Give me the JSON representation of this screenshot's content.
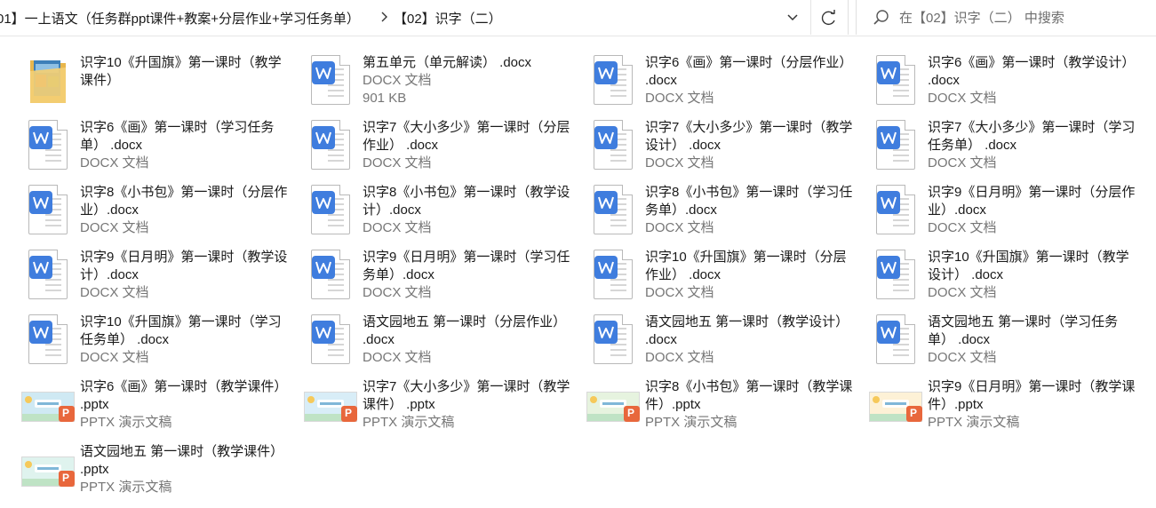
{
  "breadcrumb": {
    "path_label": "01】一上语文（任务群ppt课件+教案+分层作业+学习任务单）",
    "current_label": "【02】识字（二）"
  },
  "search": {
    "placeholder": "在【02】识字（二） 中搜索"
  },
  "files": [
    {
      "name": "识字10《升国旗》第一课时（教学课件）",
      "type": "",
      "size": "",
      "icon": "folder-icon"
    },
    {
      "name": "第五单元（单元解读） .docx",
      "type": "DOCX 文档",
      "size": "901 KB",
      "icon": "word-doc-icon"
    },
    {
      "name": "识字6《画》第一课时（分层作业） .docx",
      "type": "DOCX 文档",
      "size": "",
      "icon": "word-doc-icon"
    },
    {
      "name": "识字6《画》第一课时（教学设计） .docx",
      "type": "DOCX 文档",
      "size": "",
      "icon": "word-doc-icon"
    },
    {
      "name": "识字6《画》第一课时（学习任务单） .docx",
      "type": "DOCX 文档",
      "size": "",
      "icon": "word-doc-icon"
    },
    {
      "name": "识字7《大小多少》第一课时（分层作业） .docx",
      "type": "DOCX 文档",
      "size": "",
      "icon": "word-doc-icon"
    },
    {
      "name": "识字7《大小多少》第一课时（教学设计） .docx",
      "type": "DOCX 文档",
      "size": "",
      "icon": "word-doc-icon"
    },
    {
      "name": "识字7《大小多少》第一课时（学习任务单） .docx",
      "type": "DOCX 文档",
      "size": "",
      "icon": "word-doc-icon"
    },
    {
      "name": "识字8《小书包》第一课时（分层作业）.docx",
      "type": "DOCX 文档",
      "size": "",
      "icon": "word-doc-icon"
    },
    {
      "name": "识字8《小书包》第一课时（教学设计）.docx",
      "type": "DOCX 文档",
      "size": "",
      "icon": "word-doc-icon"
    },
    {
      "name": "识字8《小书包》第一课时（学习任务单）.docx",
      "type": "DOCX 文档",
      "size": "",
      "icon": "word-doc-icon"
    },
    {
      "name": "识字9《日月明》第一课时（分层作业）.docx",
      "type": "DOCX 文档",
      "size": "",
      "icon": "word-doc-icon"
    },
    {
      "name": "识字9《日月明》第一课时（教学设计）.docx",
      "type": "DOCX 文档",
      "size": "",
      "icon": "word-doc-icon"
    },
    {
      "name": "识字9《日月明》第一课时（学习任务单）.docx",
      "type": "DOCX 文档",
      "size": "",
      "icon": "word-doc-icon"
    },
    {
      "name": "识字10《升国旗》第一课时（分层作业） .docx",
      "type": "DOCX 文档",
      "size": "",
      "icon": "word-doc-icon"
    },
    {
      "name": "识字10《升国旗》第一课时（教学设计） .docx",
      "type": "DOCX 文档",
      "size": "",
      "icon": "word-doc-icon"
    },
    {
      "name": "识字10《升国旗》第一课时（学习任务单） .docx",
      "type": "DOCX 文档",
      "size": "",
      "icon": "word-doc-icon"
    },
    {
      "name": "语文园地五 第一课时（分层作业） .docx",
      "type": "DOCX 文档",
      "size": "",
      "icon": "word-doc-icon"
    },
    {
      "name": "语文园地五 第一课时（教学设计） .docx",
      "type": "DOCX 文档",
      "size": "",
      "icon": "word-doc-icon"
    },
    {
      "name": "语文园地五 第一课时（学习任务单） .docx",
      "type": "DOCX 文档",
      "size": "",
      "icon": "word-doc-icon"
    },
    {
      "name": "识字6《画》第一课时（教学课件） .pptx",
      "type": "PPTX 演示文稿",
      "size": "",
      "icon": "pptx-thumbnail-icon",
      "thumb_color": "#cfe9f3"
    },
    {
      "name": "识字7《大小多少》第一课时（教学课件） .pptx",
      "type": "PPTX 演示文稿",
      "size": "",
      "icon": "pptx-thumbnail-icon",
      "thumb_color": "#d8edf7"
    },
    {
      "name": "识字8《小书包》第一课时（教学课件）.pptx",
      "type": "PPTX 演示文稿",
      "size": "",
      "icon": "pptx-thumbnail-icon",
      "thumb_color": "#e6f3df"
    },
    {
      "name": "识字9《日月明》第一课时（教学课件）.pptx",
      "type": "PPTX 演示文稿",
      "size": "",
      "icon": "pptx-thumbnail-icon",
      "thumb_color": "#fdf1d6"
    },
    {
      "name": "语文园地五 第一课时（教学课件） .pptx",
      "type": "PPTX 演示文稿",
      "size": "",
      "icon": "pptx-thumbnail-icon",
      "thumb_color": "#dff3ee"
    }
  ],
  "colors": {
    "word_blue": "#3f7dde",
    "ppt_orange": "#e8673c",
    "meta_gray": "#767676"
  }
}
